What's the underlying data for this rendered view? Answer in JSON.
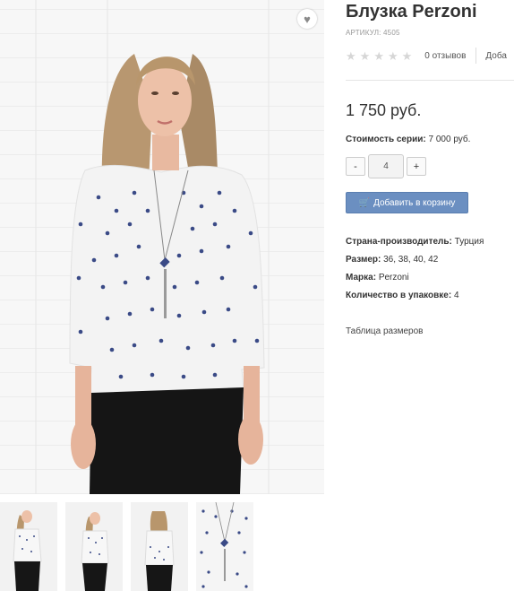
{
  "product": {
    "title": "Блузка Perzoni",
    "sku_label": "АРТИКУЛ:",
    "sku_value": "4505",
    "rating_stars": 0,
    "reviews_label": "0 отзывов",
    "add_label": "Доба",
    "price": "1 750 руб.",
    "series_label": "Стоимость серии:",
    "series_value": "7 000 руб.",
    "quantity": "4",
    "minus_label": "-",
    "plus_label": "+",
    "cart_button": "Добавить в корзину",
    "properties": [
      {
        "label": "Страна-производитель:",
        "value": "Турция"
      },
      {
        "label": "Размер:",
        "value": "36, 38, 40, 42"
      },
      {
        "label": "Марка:",
        "value": "Perzoni"
      },
      {
        "label": "Количество в упаковке:",
        "value": "4"
      }
    ],
    "size_table_link": "Таблица размеров"
  },
  "icons": {
    "favorite": "heart-icon",
    "cart": "shopping-cart-icon",
    "star": "star-icon"
  },
  "colors": {
    "cart_button": "#6b8fc1",
    "star_empty": "#d6d6d6"
  },
  "thumbnails": [
    "front-view",
    "half-turn-view",
    "back-view",
    "detail-view"
  ]
}
